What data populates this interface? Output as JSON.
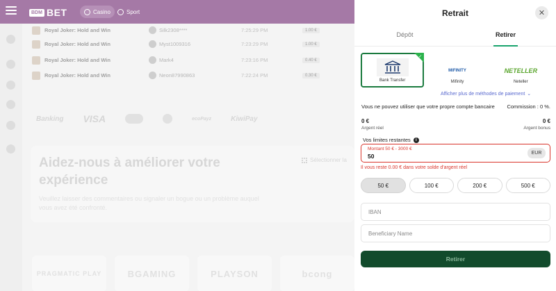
{
  "header": {
    "logo_box": "BDM",
    "logo_text": "BET",
    "nav": [
      {
        "label": "Casino"
      },
      {
        "label": "Sport"
      }
    ]
  },
  "bets": [
    {
      "game": "Royal Joker: Hold and Win",
      "user": "Silk2308****",
      "time": "7:25:29 PM",
      "amount": "1.00 €"
    },
    {
      "game": "Royal Joker: Hold and Win",
      "user": "Myst1009316",
      "time": "7:23:29 PM",
      "amount": "1.00 €"
    },
    {
      "game": "Royal Joker: Hold and Win",
      "user": "Mark4",
      "time": "7:23:16 PM",
      "amount": "0.40 €"
    },
    {
      "game": "Royal Joker: Hold and Win",
      "user": "Neon87990863",
      "time": "7:22:24 PM",
      "amount": "0.30 €"
    }
  ],
  "payments_strip": [
    "Banking",
    "VISA",
    "ecoPayz",
    "KiwiPay"
  ],
  "feedback": {
    "title": "Aidez-nous à améliorer votre expérience",
    "text": "Veuillez laisser des commentaires ou signaler un bogue ou un problème auquel vous avez été confronté.",
    "select_label": "Sélectionner la"
  },
  "providers": [
    "PRAGMATIC PLAY",
    "BGAMING",
    "PLAYSON",
    "bcong"
  ],
  "modal": {
    "title": "Retrait",
    "close": "✕",
    "tabs": [
      {
        "label": "Dépôt"
      },
      {
        "label": "Retirer"
      }
    ],
    "methods": [
      {
        "name": "Bank Transfer",
        "logo": "bank-icon"
      },
      {
        "name": "Mifinity",
        "logo": "MIFINITY"
      },
      {
        "name": "Neteller",
        "logo": "NETELLER"
      }
    ],
    "more_methods": "Afficher plus de méthodes de paiement",
    "own_account_notice": "Vous ne pouvez utiliser que votre propre compte bancaire",
    "commission": "Commission : 0 %.",
    "real_balance": "0 €",
    "real_balance_label": "Argent réel",
    "bonus_balance": "0 €",
    "bonus_balance_label": "Argent bonus",
    "limits_label": "Vos limites restantes",
    "amount_hint": "Montant 50 € - 3000 €",
    "amount_value": "50",
    "currency": "EUR",
    "error_text": "Il vous reste 0.00 € dans votre solde d'argent réel",
    "quick_amounts": [
      "50 €",
      "100 €",
      "200 €",
      "500 €"
    ],
    "iban_placeholder": "IBAN",
    "beneficiary_placeholder": "Beneficiary Name",
    "submit_label": "Retirer"
  },
  "colors": {
    "brand_purple": "#6f2870",
    "accent_green": "#17a36c",
    "submit_green": "#124b2c",
    "error_red": "#d9342b"
  }
}
